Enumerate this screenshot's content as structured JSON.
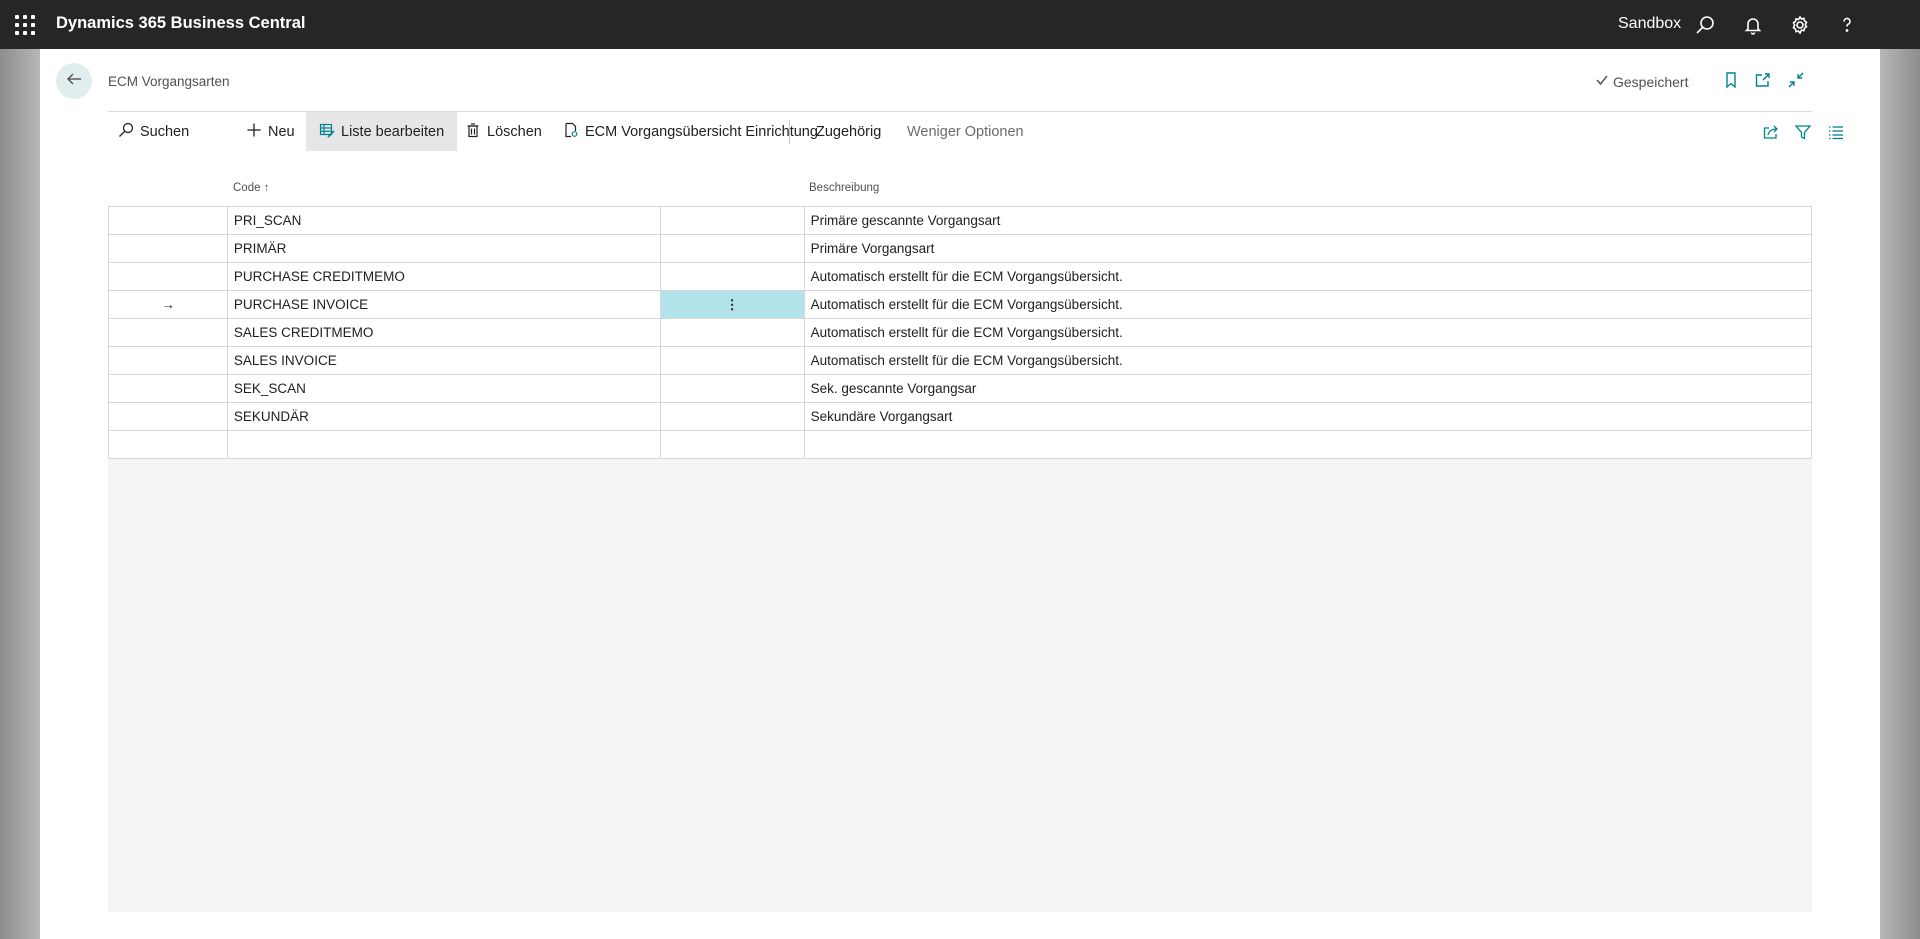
{
  "topbar": {
    "app_name": "Dynamics 365 Business Central",
    "environment": "Sandbox",
    "icons": [
      "waffle-icon",
      "search-icon",
      "bell-icon",
      "gear-icon",
      "help-icon"
    ]
  },
  "header": {
    "title": "ECM Vorgangsarten",
    "saved_status": "Gespeichert",
    "icons": [
      "back-arrow-icon",
      "checkmark-icon",
      "bookmark-icon",
      "open-new-window-icon",
      "collapse-icon"
    ]
  },
  "actions": {
    "search": "Suchen",
    "new": "Neu",
    "edit_list": "Liste bearbeiten",
    "delete": "Löschen",
    "overview_setup": "ECM Vorgangsübersicht Einrichtung",
    "related": "Zugehörig",
    "fewer_options": "Weniger Optionen"
  },
  "grid": {
    "columns": {
      "code": "Code",
      "sort_indicator": "↑",
      "description": "Beschreibung"
    },
    "selected_row_marker": "→",
    "row_menu_icon": "⋮",
    "rows": [
      {
        "code": "PRI_SCAN",
        "description": "Primäre gescannte Vorgangsart"
      },
      {
        "code": "PRIMÄR",
        "description": "Primäre Vorgangsart"
      },
      {
        "code": "PURCHASE CREDITMEMO",
        "description": "Automatisch erstellt für die ECM Vorgangsübersicht."
      },
      {
        "code": "PURCHASE INVOICE",
        "description": "Automatisch erstellt für die ECM Vorgangsübersicht."
      },
      {
        "code": "SALES CREDITMEMO",
        "description": "Automatisch erstellt für die ECM Vorgangsübersicht."
      },
      {
        "code": "SALES INVOICE",
        "description": "Automatisch erstellt für die ECM Vorgangsübersicht."
      },
      {
        "code": "SEK_SCAN",
        "description": "Sek. gescannte Vorgangsar"
      },
      {
        "code": "SEKUNDÄR",
        "description": "Sekundäre Vorgangsart"
      },
      {
        "code": "",
        "description": ""
      }
    ]
  },
  "colors": {
    "topbar": "#262626",
    "selection": "#b3e3ea",
    "accent": "#00838f"
  }
}
